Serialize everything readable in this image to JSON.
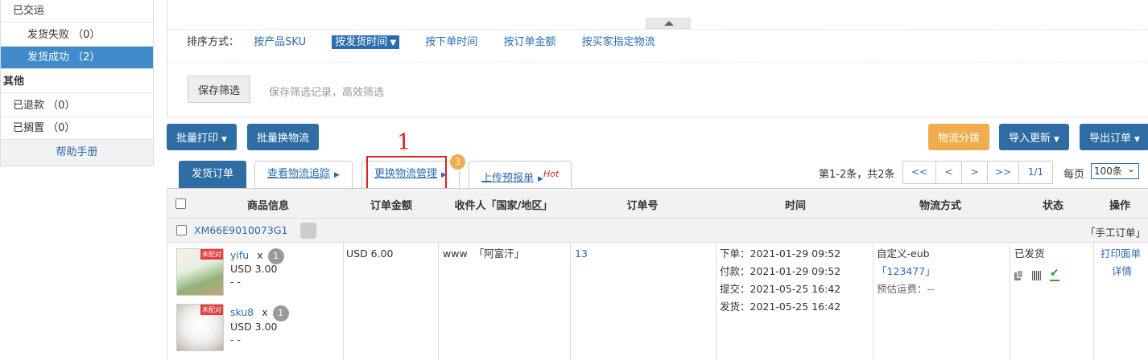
{
  "sidebar": {
    "shipped": "已交运",
    "ship_failed": "发货失败 （0）",
    "ship_success": "发货成功 （2）",
    "other_group": "其他",
    "refunded": "已退款 （0）",
    "shelved": "已搁置 （0）",
    "help": "帮助手册"
  },
  "filter": {
    "sort_label": "排序方式：",
    "sort_options": [
      "按产品SKU",
      "按发货时间",
      "按下单时间",
      "按订单金额",
      "按买家指定物流"
    ],
    "save_button": "保存筛选",
    "save_hint": "保存筛选记录，高效筛选"
  },
  "toolbar": {
    "batch_print": "批量打印",
    "batch_change_logistics": "批量换物流",
    "logistics_dispatch": "物流分拨",
    "import_update": "导入更新",
    "export_orders": "导出订单"
  },
  "tabs": {
    "ship_orders": "发货订单",
    "view_tracking": "查看物流追踪",
    "change_logistics": "更换物流管理",
    "change_logistics_badge": "3",
    "upload_forecast": "上传预报单",
    "hot": "Hot"
  },
  "annotation": {
    "number": "1"
  },
  "pager": {
    "info": "第1-2条，共2条",
    "first": "<<",
    "prev": "<",
    "next": ">",
    "last": ">>",
    "page": "1/1",
    "per_page_label": "每页",
    "per_page_value": "100条"
  },
  "table": {
    "headers": [
      "商品信息",
      "订单金额",
      "收件人「国家/地区」",
      "订单号",
      "时间",
      "物流方式",
      "状态",
      "操作"
    ],
    "order_no": "XM66E9010073G1",
    "manual_tag": "「手工订单」",
    "products": [
      {
        "badge": "未配对",
        "name": "yifu",
        "x": "x",
        "qty": "1",
        "price": "USD 3.00",
        "extra": "- -"
      },
      {
        "badge": "未配对",
        "name": "sku8",
        "x": "x",
        "qty": "1",
        "price": "USD 3.00",
        "extra": "- -"
      }
    ],
    "amount": "USD 6.00",
    "recipient": "www  「阿富汗」",
    "order_id": "13",
    "times": [
      "下单：2021-01-29 09:52",
      "付款：2021-01-29 09:52",
      "提交：2021-05-25 16:42",
      "发货：2021-05-25 16:42"
    ],
    "logistics_name": "自定义-eub",
    "tracking": "「123477」",
    "est_fee": "预估运费：--",
    "status": "已发货",
    "action_print": "打印面单",
    "action_detail": "详情"
  },
  "colors": {
    "primary": "#2e6da4",
    "active_row": "#428bca",
    "warning": "#f0ad4e",
    "annotation": "#e02020"
  }
}
